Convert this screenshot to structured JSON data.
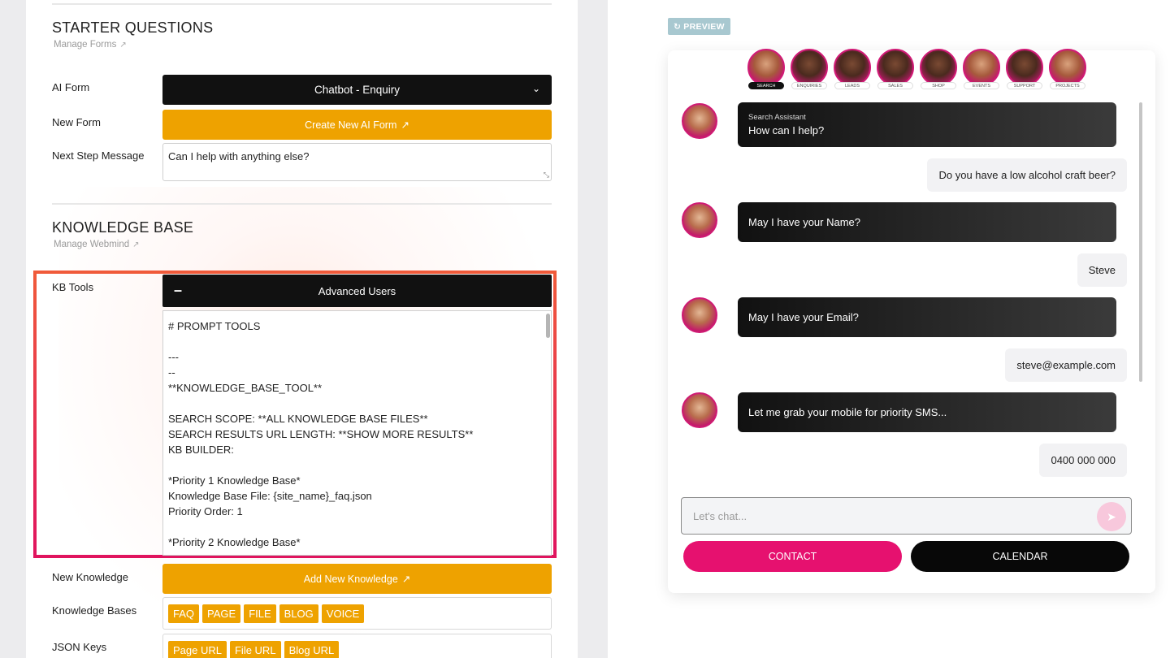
{
  "starter": {
    "title": "STARTER QUESTIONS",
    "manage_link": "Manage Forms",
    "ai_form_label": "AI Form",
    "ai_form_value": "Chatbot - Enquiry",
    "new_form_label": "New Form",
    "new_form_button": "Create New AI Form",
    "next_step_label": "Next Step Message",
    "next_step_value": "Can I help with anything else?"
  },
  "knowledge": {
    "title": "KNOWLEDGE BASE",
    "manage_link": "Manage Webmind",
    "kb_tools_label": "KB Tools",
    "advanced_toggle": "Advanced Users",
    "prompt_text": "# PROMPT TOOLS\n\n---\n--\n**KNOWLEDGE_BASE_TOOL**\n\nSEARCH SCOPE: **ALL KNOWLEDGE BASE FILES**\nSEARCH RESULTS URL LENGTH: **SHOW MORE RESULTS**\nKB BUILDER:\n\n*Priority 1 Knowledge Base*\nKnowledge Base File: {site_name}_faq.json\nPriority Order: 1\n\n*Priority 2 Knowledge Base*",
    "new_knowledge_label": "New Knowledge",
    "new_knowledge_button": "Add New Knowledge",
    "bases_label": "Knowledge Bases",
    "bases": [
      "FAQ",
      "PAGE",
      "FILE",
      "BLOG",
      "VOICE"
    ],
    "json_keys_label": "JSON Keys",
    "json_keys": [
      "Page URL",
      "File URL",
      "Blog URL"
    ]
  },
  "preview": {
    "badge": "PREVIEW",
    "avatars": [
      "SEARCH",
      "ENQUIRIES",
      "LEADS",
      "SALES",
      "SHOP",
      "EVENTS",
      "SUPPORT",
      "PROJECTS"
    ],
    "assistant_name": "Search Assistant",
    "messages": [
      {
        "from": "bot",
        "text": "How can I help?"
      },
      {
        "from": "user",
        "text": "Do you have a low alcohol craft beer?"
      },
      {
        "from": "bot",
        "text": "May I have your Name?"
      },
      {
        "from": "user",
        "text": "Steve"
      },
      {
        "from": "bot",
        "text": "May I have your Email?"
      },
      {
        "from": "user",
        "text": "steve@example.com"
      },
      {
        "from": "bot",
        "text": "Let me grab your mobile for priority SMS..."
      },
      {
        "from": "user",
        "text": "0400 000 000"
      }
    ],
    "input_placeholder": "Let's chat...",
    "contact_button": "CONTACT",
    "calendar_button": "CALENDAR"
  },
  "colors": {
    "orange": "#eea200",
    "pink": "#e6116f",
    "black": "#111111",
    "frame_gradient_top": "#f05a3a",
    "frame_gradient_bottom": "#e0145e"
  }
}
